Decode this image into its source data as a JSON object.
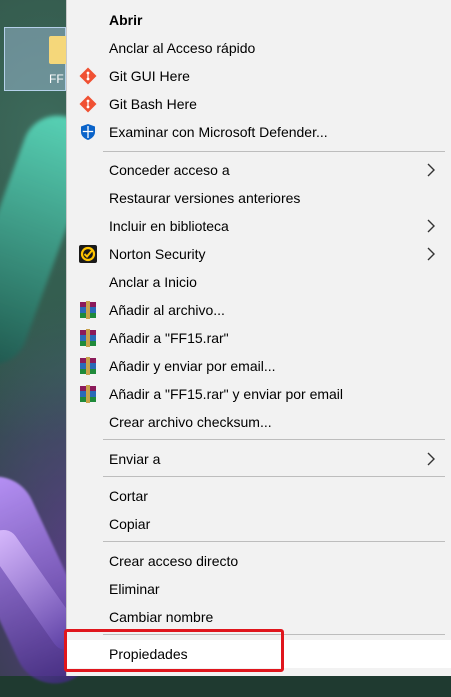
{
  "desktop": {
    "icon_label": "FF"
  },
  "menu": {
    "items": [
      {
        "label": "Abrir",
        "icon": "none"
      },
      {
        "label": "Anclar al Acceso rápido",
        "icon": "none"
      },
      {
        "label": "Git GUI Here",
        "icon": "git-icon"
      },
      {
        "label": "Git Bash Here",
        "icon": "git-icon"
      },
      {
        "label": "Examinar con Microsoft Defender...",
        "icon": "defender-shield-icon"
      },
      {
        "label": "Conceder acceso a",
        "icon": "none",
        "submenu": true
      },
      {
        "label": "Restaurar versiones anteriores",
        "icon": "none"
      },
      {
        "label": "Incluir en biblioteca",
        "icon": "none",
        "submenu": true
      },
      {
        "label": "Norton Security",
        "icon": "norton-icon",
        "submenu": true
      },
      {
        "label": "Anclar a Inicio",
        "icon": "none"
      },
      {
        "label": "Añadir al archivo...",
        "icon": "winrar-icon"
      },
      {
        "label": "Añadir a \"FF15.rar\"",
        "icon": "winrar-icon"
      },
      {
        "label": "Añadir y enviar por email...",
        "icon": "winrar-icon"
      },
      {
        "label": "Añadir a \"FF15.rar\" y enviar por email",
        "icon": "winrar-icon"
      },
      {
        "label": "Crear archivo checksum...",
        "icon": "none"
      },
      {
        "label": "Enviar a",
        "icon": "none",
        "submenu": true
      },
      {
        "label": "Cortar",
        "icon": "none"
      },
      {
        "label": "Copiar",
        "icon": "none"
      },
      {
        "label": "Crear acceso directo",
        "icon": "none"
      },
      {
        "label": "Eliminar",
        "icon": "none"
      },
      {
        "label": "Cambiar nombre",
        "icon": "none"
      },
      {
        "label": "Propiedades",
        "icon": "none"
      }
    ]
  },
  "colors": {
    "menu_bg": "#f2f2f2",
    "highlight_border": "#e0161d",
    "git_orange": "#f05133",
    "defender_blue": "#0a63c9",
    "norton_yellow": "#ffc400"
  }
}
